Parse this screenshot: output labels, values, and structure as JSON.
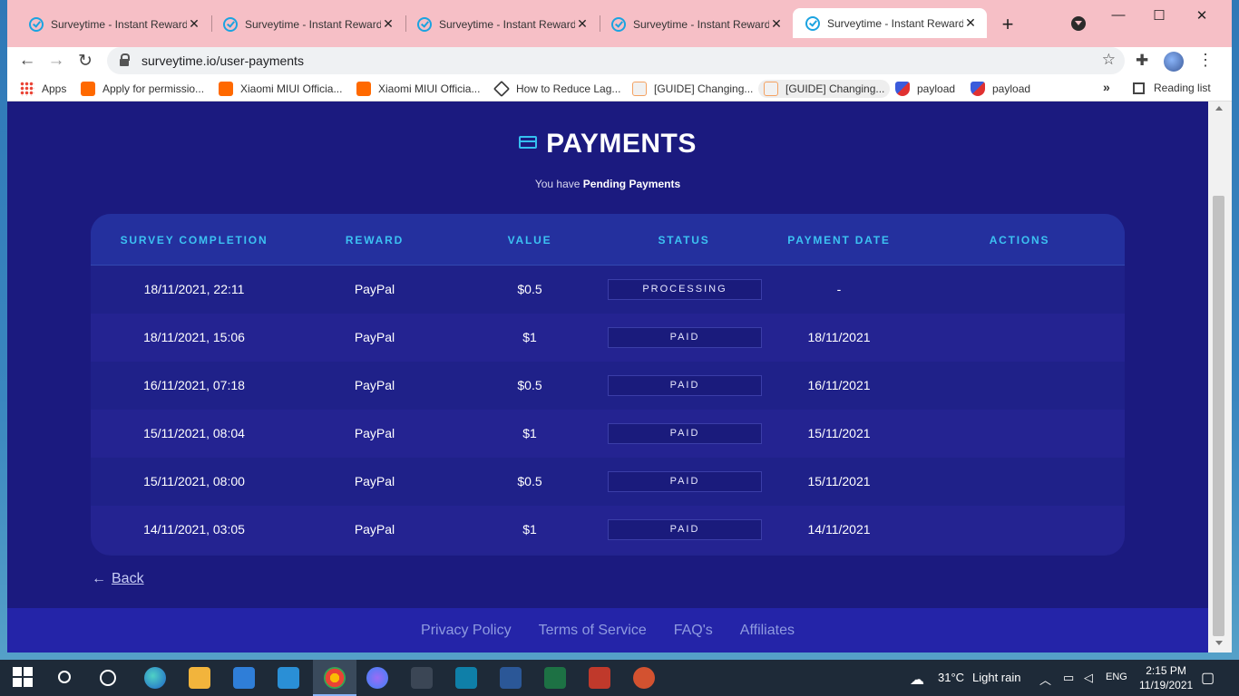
{
  "browser": {
    "tabs": [
      {
        "title": "Surveytime - Instant Reward",
        "active": false
      },
      {
        "title": "Surveytime - Instant Reward",
        "active": false
      },
      {
        "title": "Surveytime - Instant Reward",
        "active": false
      },
      {
        "title": "Surveytime - Instant Reward",
        "active": false
      },
      {
        "title": "Surveytime - Instant Reward",
        "active": true
      }
    ],
    "url": "surveytime.io/user-payments",
    "bookmarks": [
      {
        "label": "Apps",
        "icon": "apps-grid-icon"
      },
      {
        "label": "Apply for permissio...",
        "icon": "miui-icon"
      },
      {
        "label": "Xiaomi MIUI Officia...",
        "icon": "miui-icon"
      },
      {
        "label": "Xiaomi MIUI Officia...",
        "icon": "miui-icon"
      },
      {
        "label": "How to Reduce Lag...",
        "icon": "heart-icon"
      },
      {
        "label": "[GUIDE] Changing...",
        "icon": "xda-icon"
      },
      {
        "label": "[GUIDE] Changing...",
        "icon": "xda-icon"
      },
      {
        "label": "payload",
        "icon": "shield-icon"
      },
      {
        "label": "payload",
        "icon": "shield-icon"
      }
    ],
    "reading_list": "Reading list"
  },
  "page": {
    "title": "PAYMENTS",
    "subtitle_prefix": "You have",
    "subtitle_bold": "Pending Payments",
    "columns": [
      "SURVEY COMPLETION",
      "REWARD",
      "VALUE",
      "STATUS",
      "PAYMENT DATE",
      "ACTIONS"
    ],
    "rows": [
      {
        "completion": "18/11/2021, 22:11",
        "reward": "PayPal",
        "value": "$0.5",
        "status": "PROCESSING",
        "payment_date": "-"
      },
      {
        "completion": "18/11/2021, 15:06",
        "reward": "PayPal",
        "value": "$1",
        "status": "PAID",
        "payment_date": "18/11/2021"
      },
      {
        "completion": "16/11/2021, 07:18",
        "reward": "PayPal",
        "value": "$0.5",
        "status": "PAID",
        "payment_date": "16/11/2021"
      },
      {
        "completion": "15/11/2021, 08:04",
        "reward": "PayPal",
        "value": "$1",
        "status": "PAID",
        "payment_date": "15/11/2021"
      },
      {
        "completion": "15/11/2021, 08:00",
        "reward": "PayPal",
        "value": "$0.5",
        "status": "PAID",
        "payment_date": "15/11/2021"
      },
      {
        "completion": "14/11/2021, 03:05",
        "reward": "PayPal",
        "value": "$1",
        "status": "PAID",
        "payment_date": "14/11/2021"
      }
    ],
    "back_label": "Back",
    "footer_links": [
      "Privacy Policy",
      "Terms of Service",
      "FAQ's",
      "Affiliates"
    ]
  },
  "taskbar": {
    "weather_temp": "31°C",
    "weather_text": "Light rain",
    "language": "ENG",
    "time": "2:15 PM",
    "date": "11/19/2021"
  },
  "colors": {
    "page_bg": "#1b1a7f",
    "header_accent": "#3cc2f2",
    "footer_bg": "#2424a8",
    "tabstrip_bg": "#f6bfc6"
  }
}
